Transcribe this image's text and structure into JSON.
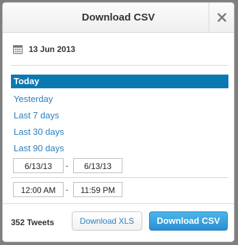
{
  "dialog": {
    "title": "Download CSV"
  },
  "date_display": "13 Jun 2013",
  "ranges": [
    {
      "label": "Today",
      "selected": true
    },
    {
      "label": "Yesterday",
      "selected": false
    },
    {
      "label": "Last 7 days",
      "selected": false
    },
    {
      "label": "Last 30 days",
      "selected": false
    },
    {
      "label": "Last 90 days",
      "selected": false
    }
  ],
  "date_range": {
    "start": "6/13/13",
    "separator": "-",
    "end": "6/13/13"
  },
  "time_range": {
    "start": "12:00 AM",
    "separator": "-",
    "end": "11:59 PM"
  },
  "footer": {
    "tweet_count": "352 Tweets",
    "download_xls_label": "Download XLS",
    "download_csv_label": "Download CSV"
  },
  "icons": {
    "close": "close-icon",
    "calendar": "calendar-icon"
  },
  "colors": {
    "accent": "#0b79b1",
    "link": "#2a7fbf",
    "primary_button": "#2a8fd3"
  }
}
